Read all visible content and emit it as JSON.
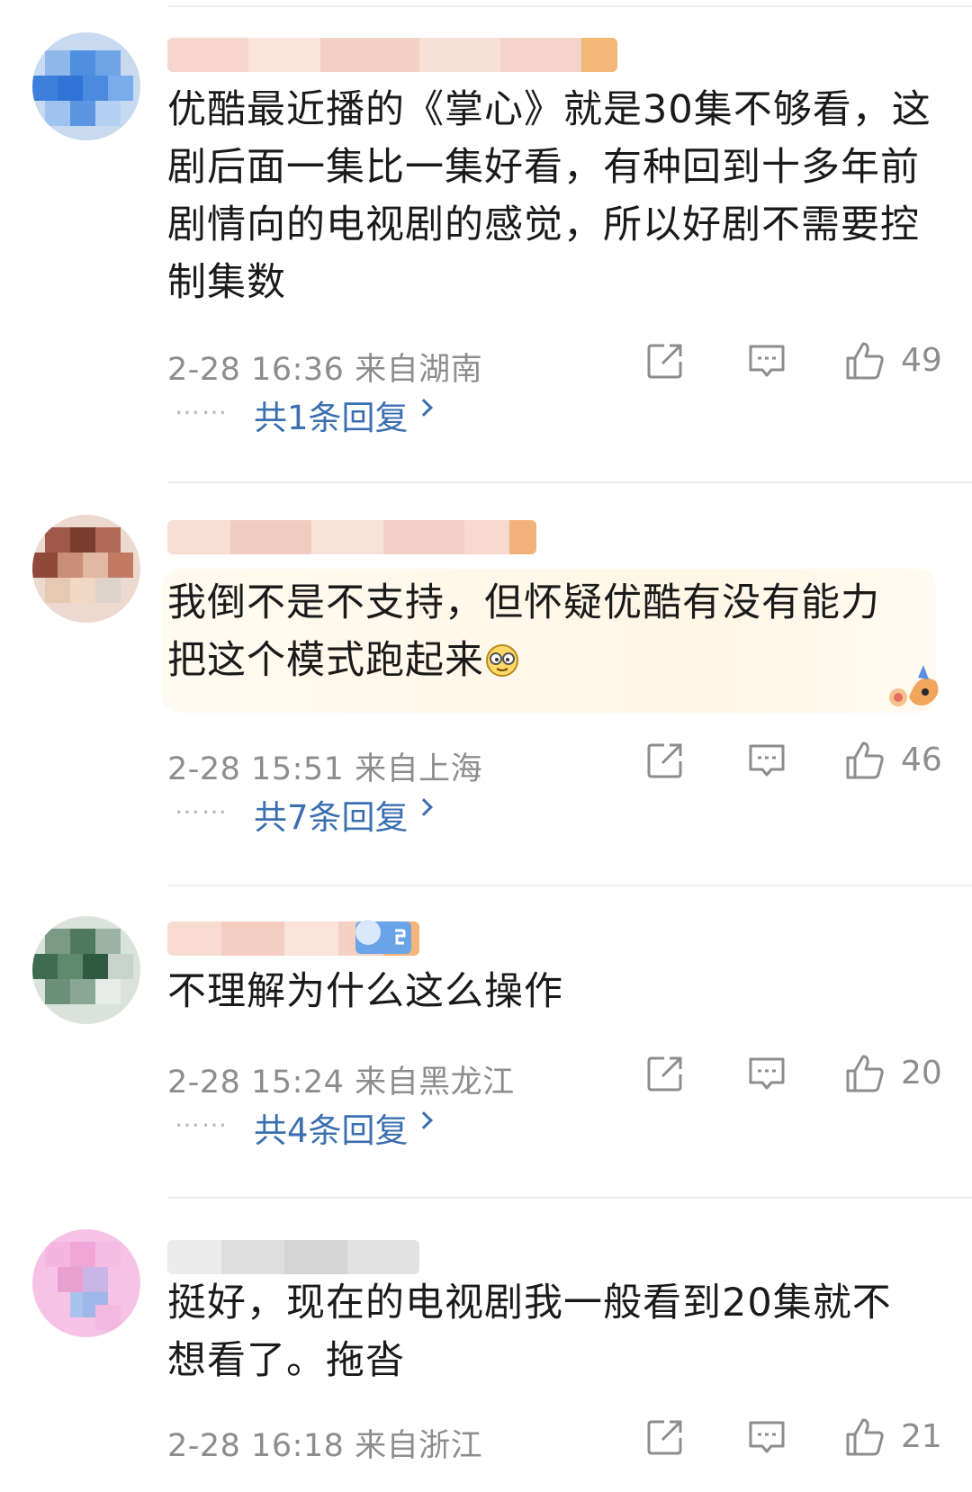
{
  "comments": [
    {
      "text": "优酷最近播的《掌心》就是30集不够看，这剧后面一集比一集好看，有种回到十多年前剧情向的电视剧的感觉，所以好剧不需要控制集数",
      "time": "2-28 16:36",
      "location": "来自湖南",
      "likes": "49",
      "replies_label": "共1条回复",
      "replies_dots": "……"
    },
    {
      "text": "我倒不是不支持，但怀疑优酷有没有能力把这个模式跑起来",
      "emoji": "smiley-emoji",
      "time": "2-28 15:51",
      "location": "来自上海",
      "likes": "46",
      "replies_label": "共7条回复",
      "replies_dots": "……"
    },
    {
      "text": "不理解为什么这么操作",
      "time": "2-28 15:24",
      "location": "来自黑龙江",
      "likes": "20",
      "replies_label": "共4条回复",
      "replies_dots": "……"
    },
    {
      "text": "挺好，现在的电视剧我一般看到20集就不想看了。拖沓",
      "time": "2-28 16:18",
      "location": "来自浙江",
      "likes": "21"
    }
  ],
  "icons": {
    "share": "share-icon",
    "reply": "comment-icon",
    "like": "thumbs-up-icon",
    "sticker": "decorative-sticker-icon"
  },
  "colors": {
    "link": "#3b6fb0",
    "meta": "#8d8d8d",
    "highlight_bg": "#fff6e6"
  }
}
